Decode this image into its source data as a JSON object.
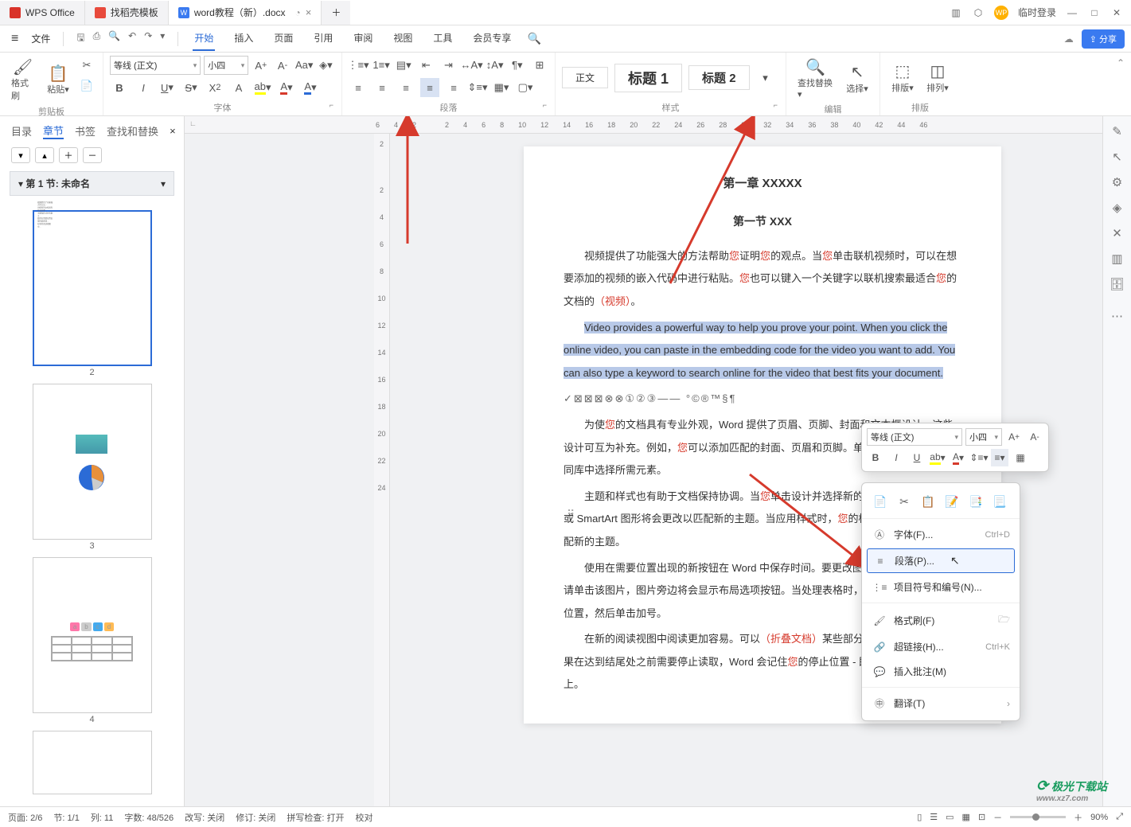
{
  "tabs": [
    {
      "icon": "#d9332a",
      "label": "WPS Office"
    },
    {
      "icon": "#e84a3c",
      "label": "找稻壳模板"
    },
    {
      "icon": "#3a7af0",
      "label": "word教程（新）.docx",
      "active": true
    }
  ],
  "titlebar_right": {
    "login": "临时登录"
  },
  "menubar": {
    "file": "文件",
    "tabs": [
      "开始",
      "插入",
      "页面",
      "引用",
      "审阅",
      "视图",
      "工具",
      "会员专享"
    ],
    "active_tab": "开始",
    "share": "分享"
  },
  "ribbon": {
    "clipboard": {
      "name": "剪贴板",
      "format_painter": "格式刷",
      "paste": "粘贴"
    },
    "font": {
      "name": "字体",
      "family": "等线 (正文)",
      "size": "小四"
    },
    "paragraph": {
      "name": "段落"
    },
    "styles": {
      "name": "样式",
      "items": [
        "正文",
        "标题 1",
        "标题 2"
      ]
    },
    "edit": {
      "name": "编辑",
      "find": "查找替换",
      "select": "选择"
    },
    "layout": {
      "name": "排版",
      "arrange": "排版",
      "arrange2": "排列"
    }
  },
  "sidepanel": {
    "tabs": [
      "目录",
      "章节",
      "书签",
      "查找和替换"
    ],
    "active": "章节",
    "section": "第 1 节: 未命名",
    "thumbs": [
      "2",
      "3",
      "4"
    ]
  },
  "ruler_h": [
    "6",
    "4",
    "2",
    "",
    "2",
    "4",
    "6",
    "8",
    "10",
    "12",
    "14",
    "16",
    "18",
    "20",
    "22",
    "24",
    "26",
    "28",
    "30",
    "32",
    "34",
    "36",
    "38",
    "40",
    "42",
    "44",
    "46"
  ],
  "ruler_v": [
    "2",
    "",
    "2",
    "4",
    "6",
    "8",
    "10",
    "12",
    "14",
    "16",
    "18",
    "20",
    "22",
    "24"
  ],
  "doc": {
    "title": "第一章 XXXXX",
    "section": "第一节 XXX",
    "p1_a": "视频提供了功能强大的方法帮助",
    "p1_b": "证明",
    "p1_c": "的观点。当",
    "p1_d": "单击联机视频时，可以在想要添加的视频的嵌入代码中进行粘贴。",
    "p1_e": "也可以键入一个关键字以联机搜索最适合",
    "p1_f": "的文档的",
    "p1_g": "（视频）",
    "p1_h": "。",
    "p2": "Video provides a powerful way to help you prove your point. When you click the online video, you can paste in the embedding code for the video you want to add. You can also type a keyword to search online for the video that best fits your document.",
    "sym": "✓⊠⊠⊠⊗⊗①②③——   °©®™§¶",
    "p3_a": "为使",
    "p3_b": "的文档具有专业外观，Word 提供了页眉、页脚、封面和文本框设计，这些设计可互为补充。例如，",
    "p3_c": "可以添加匹配的封面、页眉和页脚。单击\"插入\"，然后从不同库中选择所需元素。",
    "p4_a": "主题和样式也有助于文档保持协调。当",
    "p4_b": "单击设计并选择新的主题时，图片、图表或 SmartArt 图形将会更改以匹配新的主题。当应用样式时，",
    "p4_c": "的标题会进行更改以匹配新的主题。",
    "p5": "使用在需要位置出现的新按钮在 Word 中保存时间。要更改图片适应文档的方式，请单击该图片，图片旁边将会显示布局选项按钮。当处理表格时，单击要添加行或列的位置，然后单击加号。",
    "p6_a": "在新的阅读视图中阅读更加容易。可以",
    "p6_b": "（折叠文档）",
    "p6_c": "某些部分并关注所需文本。如果在达到结尾处之前需要停止读取，Word 会记住",
    "p6_d": "的停止位置 - 即使在另一个设备上。",
    "you": "您"
  },
  "mini": {
    "font": "等线 (正文)",
    "size": "小四"
  },
  "ctx": {
    "font": "字体(F)...",
    "font_sc": "Ctrl+D",
    "para": "段落(P)...",
    "bullets": "项目符号和编号(N)...",
    "painter": "格式刷(F)",
    "link": "超链接(H)...",
    "link_sc": "Ctrl+K",
    "comment": "插入批注(M)",
    "translate": "翻译(T)"
  },
  "status": {
    "page": "页面: 2/6",
    "sec": "节: 1/1",
    "col": "列: 11",
    "words": "字数: 48/526",
    "rev": "改写: 关闭",
    "track": "修订: 关闭",
    "spell": "拼写检查: 打开",
    "proof": "校对",
    "zoom": "90%"
  },
  "watermark": {
    "main": "极光下载站",
    "sub": "www.xz7.com"
  }
}
